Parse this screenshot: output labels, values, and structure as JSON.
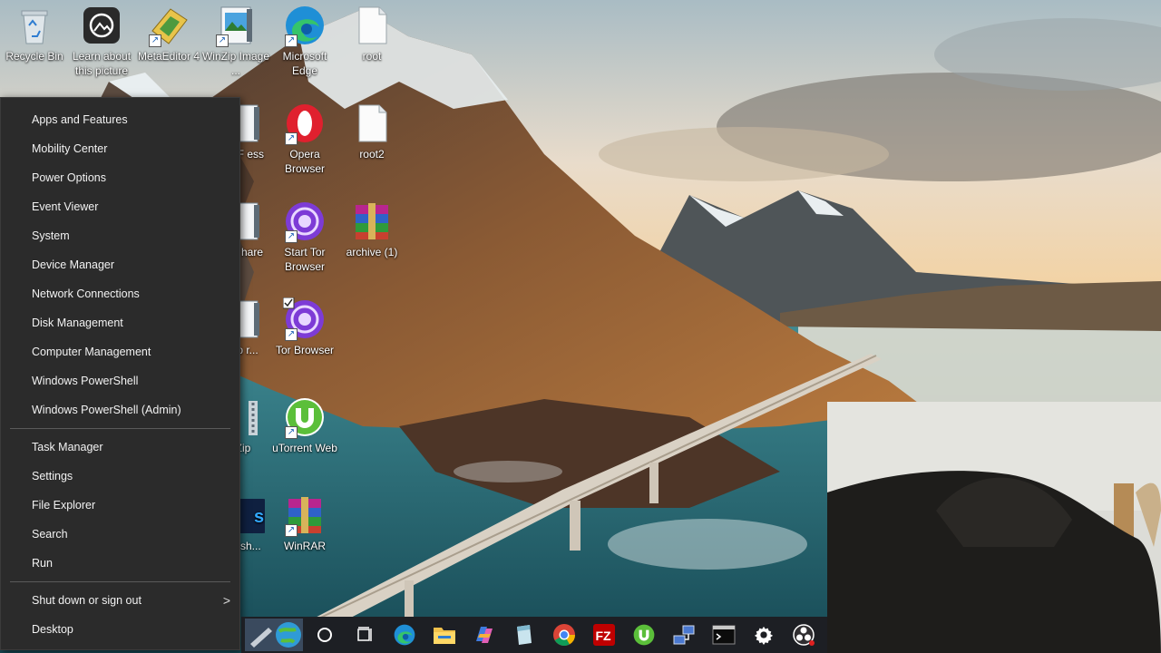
{
  "desktop": {
    "icons": [
      {
        "label": "Recycle Bin",
        "icon": "recycle-bin-icon"
      },
      {
        "label": "Learn about this picture",
        "icon": "camera-icon"
      },
      {
        "label": "MetaEditor 4",
        "icon": "metaeditor-icon"
      },
      {
        "label": "WinZip Image ...",
        "icon": "winzip-image-icon"
      },
      {
        "label": "Microsoft Edge",
        "icon": "edge-icon"
      },
      {
        "label": "root",
        "icon": "file-icon"
      },
      {
        "label": "PDF ess",
        "icon": "pdf-icon"
      },
      {
        "label": "Opera Browser",
        "icon": "opera-icon"
      },
      {
        "label": "root2",
        "icon": "file-icon"
      },
      {
        "label": "Zip hare",
        "icon": "zip-icon"
      },
      {
        "label": "Start Tor Browser",
        "icon": "tor-icon"
      },
      {
        "label": "archive (1)",
        "icon": "winrar-archive-icon"
      },
      {
        "label": "Zip r...",
        "icon": "zip-icon"
      },
      {
        "label": "Tor Browser",
        "icon": "tor-icon"
      },
      {
        "label": "Zip",
        "icon": "zip-icon"
      },
      {
        "label": "uTorrent Web",
        "icon": "utorrent-icon"
      },
      {
        "label": "be sh...",
        "icon": "photoshop-icon"
      },
      {
        "label": "WinRAR",
        "icon": "winrar-icon"
      }
    ]
  },
  "winx_menu": {
    "group1": [
      "Apps and Features",
      "Mobility Center",
      "Power Options",
      "Event Viewer",
      "System",
      "Device Manager",
      "Network Connections",
      "Disk Management",
      "Computer Management",
      "Windows PowerShell",
      "Windows PowerShell (Admin)"
    ],
    "group2": [
      "Task Manager",
      "Settings",
      "File Explorer",
      "Search",
      "Run"
    ],
    "group3": {
      "shutdown": "Shut down or sign out",
      "shutdown_arrow": ">",
      "desktop": "Desktop"
    }
  },
  "taskbar": {
    "items": [
      "start-button-icon",
      "search-circle-icon",
      "task-view-icon",
      "edge-icon",
      "file-explorer-icon",
      "copilot-icon",
      "notepad-icon",
      "chrome-icon",
      "filezilla-icon",
      "utorrent-icon",
      "network-icon",
      "terminal-icon",
      "settings-gear-icon",
      "obs-icon"
    ],
    "filezilla_text": "FZ"
  },
  "colors": {
    "menu_bg": "#2b2b2b",
    "menu_text": "#f2f2f2",
    "taskbar_bg": "#1d1f24",
    "edge_blue": "#1f8fd6",
    "tor_purple": "#7d3bd6"
  }
}
